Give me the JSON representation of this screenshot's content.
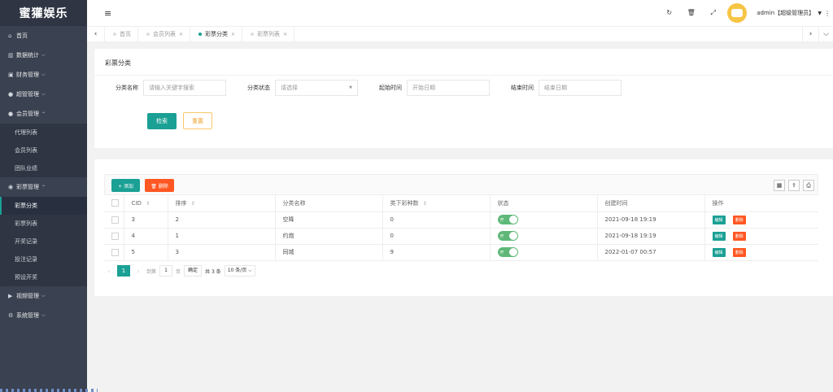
{
  "app": {
    "logo": "蜜獾娱乐"
  },
  "sidebar": {
    "items": [
      {
        "icon": "home-icon",
        "glyph": "⌂",
        "label": "首页",
        "chev": ""
      },
      {
        "icon": "bar-chart-icon",
        "glyph": "▥",
        "label": "数据统计",
        "chev": "⌵"
      },
      {
        "icon": "bank-icon",
        "glyph": "▣",
        "label": "财务管理",
        "chev": "⌵"
      },
      {
        "icon": "user-icon",
        "glyph": "●",
        "label": "超管管理",
        "chev": "⌵"
      },
      {
        "icon": "users-icon",
        "glyph": "●",
        "label": "会员管理",
        "chev": "⌃"
      }
    ],
    "member_sub": [
      {
        "label": "代理列表"
      },
      {
        "label": "会员列表"
      },
      {
        "label": "团队业绩"
      }
    ],
    "lottery": {
      "icon": "gamepad-icon",
      "glyph": "◉",
      "label": "彩票管理",
      "chev": "⌃"
    },
    "lottery_sub": [
      {
        "label": "彩票分类",
        "active": true
      },
      {
        "label": "彩票列表"
      },
      {
        "label": "开奖记录"
      },
      {
        "label": "投注记录"
      },
      {
        "label": "预设开奖"
      }
    ],
    "bottom_items": [
      {
        "icon": "video-icon",
        "glyph": "▶",
        "label": "视频管理",
        "chev": "⌵"
      },
      {
        "icon": "gear-icon",
        "glyph": "⚙",
        "label": "系统管理",
        "chev": "⌵"
      }
    ]
  },
  "header": {
    "menu_icon": "≡",
    "user_label": "admin【超级管理员】",
    "user_caret": "▼",
    "icons": [
      {
        "name": "refresh-icon",
        "glyph": "↻"
      },
      {
        "name": "trash-icon",
        "glyph": "🗑"
      },
      {
        "name": "fullscreen-icon",
        "glyph": "⤢"
      }
    ],
    "more": "⋮"
  },
  "tabs": [
    {
      "label": "首页",
      "closable": false,
      "active": false
    },
    {
      "label": "会员列表",
      "closable": true,
      "active": false
    },
    {
      "label": "彩票分类",
      "closable": true,
      "active": true
    },
    {
      "label": "彩票列表",
      "closable": true,
      "active": false
    }
  ],
  "search_panel": {
    "title": "彩票分类",
    "fields": [
      {
        "label": "分类名称",
        "placeholder": "请输入关键字搜索",
        "select": false
      },
      {
        "label": "分类状态",
        "placeholder": "请选择",
        "select": true
      },
      {
        "label": "起始时间",
        "placeholder": "开始日期",
        "select": false
      },
      {
        "label": "结束时间",
        "placeholder": "结束日期",
        "select": false
      }
    ],
    "search_label": "检索",
    "reset_label": "重置"
  },
  "table_panel": {
    "add_label": "+ 添加",
    "delete_label": "🗑 删除",
    "tool_icons": [
      {
        "name": "columns-icon",
        "glyph": "▦"
      },
      {
        "name": "export-icon",
        "glyph": "⇪"
      },
      {
        "name": "print-icon",
        "glyph": "⎙"
      }
    ],
    "columns": [
      {
        "label": "",
        "sortable": false
      },
      {
        "label": "CID",
        "sortable": true
      },
      {
        "label": "排序",
        "sortable": true
      },
      {
        "label": "分类名称",
        "sortable": false
      },
      {
        "label": "类下彩种数",
        "sortable": true
      },
      {
        "label": "状态",
        "sortable": false
      },
      {
        "label": "创建时间",
        "sortable": false
      },
      {
        "label": "操作",
        "sortable": false
      }
    ],
    "rows": [
      {
        "cid": "3",
        "sort": "2",
        "name": "空降",
        "count": "0",
        "status_text": "开",
        "created": "2021-09-18 19:19"
      },
      {
        "cid": "4",
        "sort": "1",
        "name": "约炮",
        "count": "0",
        "status_text": "开",
        "created": "2021-09-18 19:19"
      },
      {
        "cid": "5",
        "sort": "3",
        "name": "同城",
        "count": "9",
        "status_text": "开",
        "created": "2022-01-07 00:57"
      }
    ],
    "edit_label": "编辑",
    "row_delete_label": "删除",
    "pager": {
      "prev": "‹",
      "current": "1",
      "next": "›",
      "goto_label": "到第",
      "goto_value": "1",
      "page_label": "页",
      "confirm_label": "确定",
      "total": "共 3 条",
      "page_size": "10 条/页 ⌵"
    }
  }
}
